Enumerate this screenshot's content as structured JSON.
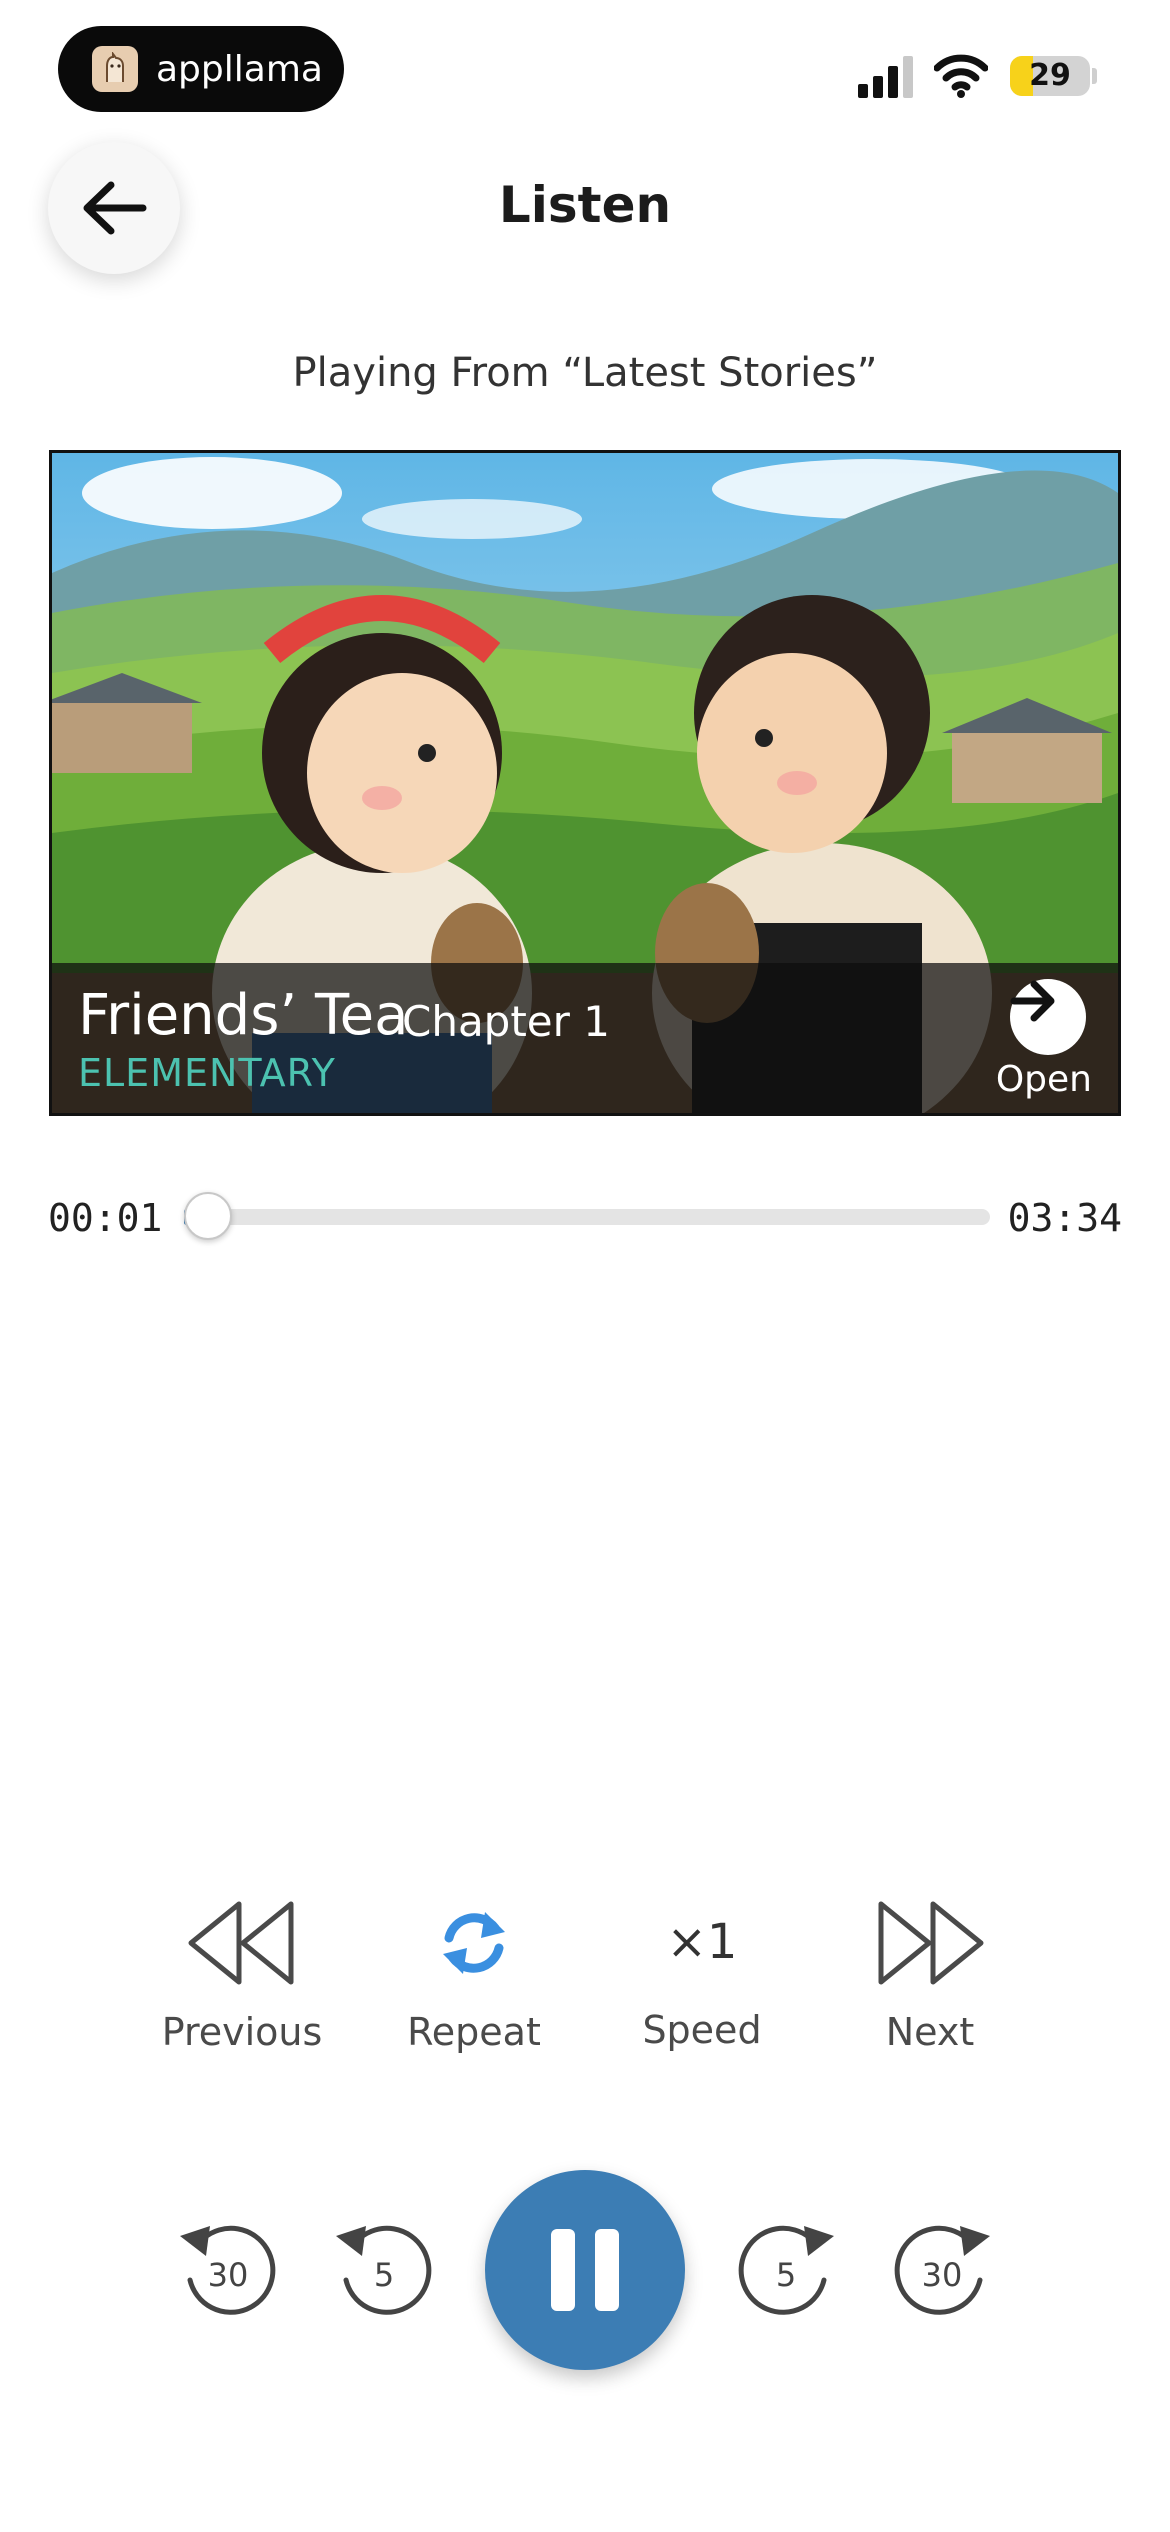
{
  "status_bar": {
    "app_name": "appllama",
    "battery_level": "29",
    "battery_fraction": 0.29
  },
  "header": {
    "title": "Listen"
  },
  "playing_from": "Playing From “Latest Stories”",
  "story": {
    "title": "Friends’ Tea",
    "chapter": "Chapter 1",
    "level": "ELEMENTARY",
    "open_label": "Open"
  },
  "progress": {
    "elapsed": "00:01",
    "duration": "03:34",
    "fraction": 0.005
  },
  "controls": {
    "previous_label": "Previous",
    "repeat_label": "Repeat",
    "speed_value": "×1",
    "speed_label": "Speed",
    "next_label": "Next"
  },
  "skip_buttons": {
    "back_30": "30",
    "back_5": "5",
    "forward_5": "5",
    "forward_30": "30"
  },
  "colors": {
    "accent": "#3c7db4",
    "level_text": "#4cc2b0",
    "repeat_icon": "#3a8fe0"
  },
  "icons": {
    "back": "arrow-left-icon",
    "open": "arrow-right-icon",
    "previous": "double-triangle-left-icon",
    "repeat": "refresh-icon",
    "next": "double-triangle-right-icon",
    "pause": "pause-icon"
  }
}
